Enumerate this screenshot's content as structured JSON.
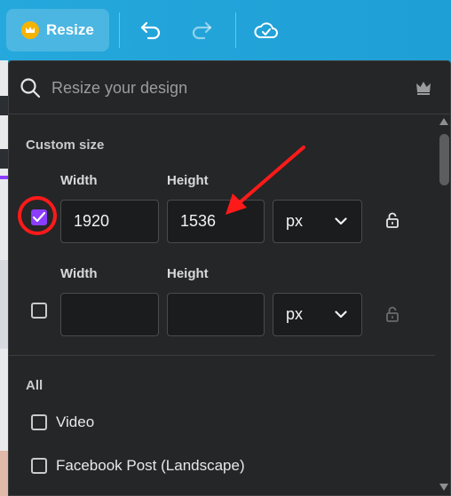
{
  "toolbar": {
    "resize_label": "Resize",
    "icons": [
      "crown-icon",
      "undo-icon",
      "redo-icon",
      "cloud-saved-icon"
    ]
  },
  "search": {
    "placeholder": "Resize your design"
  },
  "custom_size": {
    "title": "Custom size",
    "rows": [
      {
        "checked": true,
        "width_label": "Width",
        "height_label": "Height",
        "width_value": "1920",
        "height_value": "1536",
        "unit": "px"
      },
      {
        "checked": false,
        "width_label": "Width",
        "height_label": "Height",
        "width_value": "",
        "height_value": "",
        "unit": "px"
      }
    ]
  },
  "all_section": {
    "title": "All",
    "items": [
      {
        "label": "Video",
        "checked": false
      },
      {
        "label": "Facebook Post (Landscape)",
        "checked": false
      }
    ]
  },
  "colors": {
    "accent": "#8b3dff",
    "annotation": "#ff1a1a",
    "panel_bg": "#252627",
    "toolbar_bg": "#1fa7d9"
  }
}
